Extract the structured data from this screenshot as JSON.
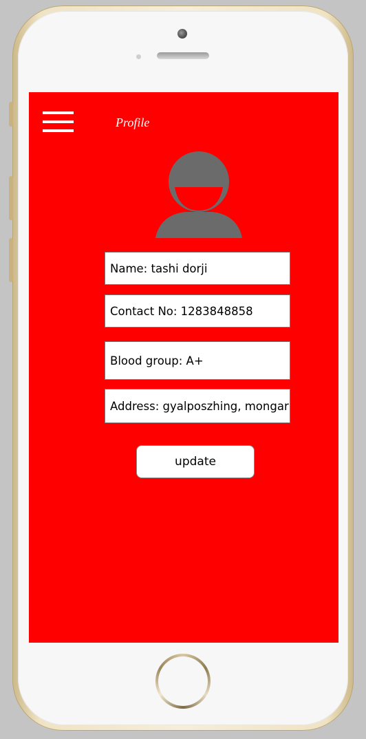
{
  "header": {
    "title": "Profile",
    "menu_icon": "hamburger-menu-icon"
  },
  "profile": {
    "avatar_icon": "user-avatar-icon",
    "name": "Name: tashi dorji",
    "contact": "Contact No: 1283848858",
    "blood_group": "Blood group: A+",
    "address": "Address: gyalposzhing, mongar"
  },
  "actions": {
    "update_label": "update"
  },
  "colors": {
    "screen_background": "#ff0000",
    "avatar": "#6b6b6b",
    "field_background": "#ffffff"
  }
}
